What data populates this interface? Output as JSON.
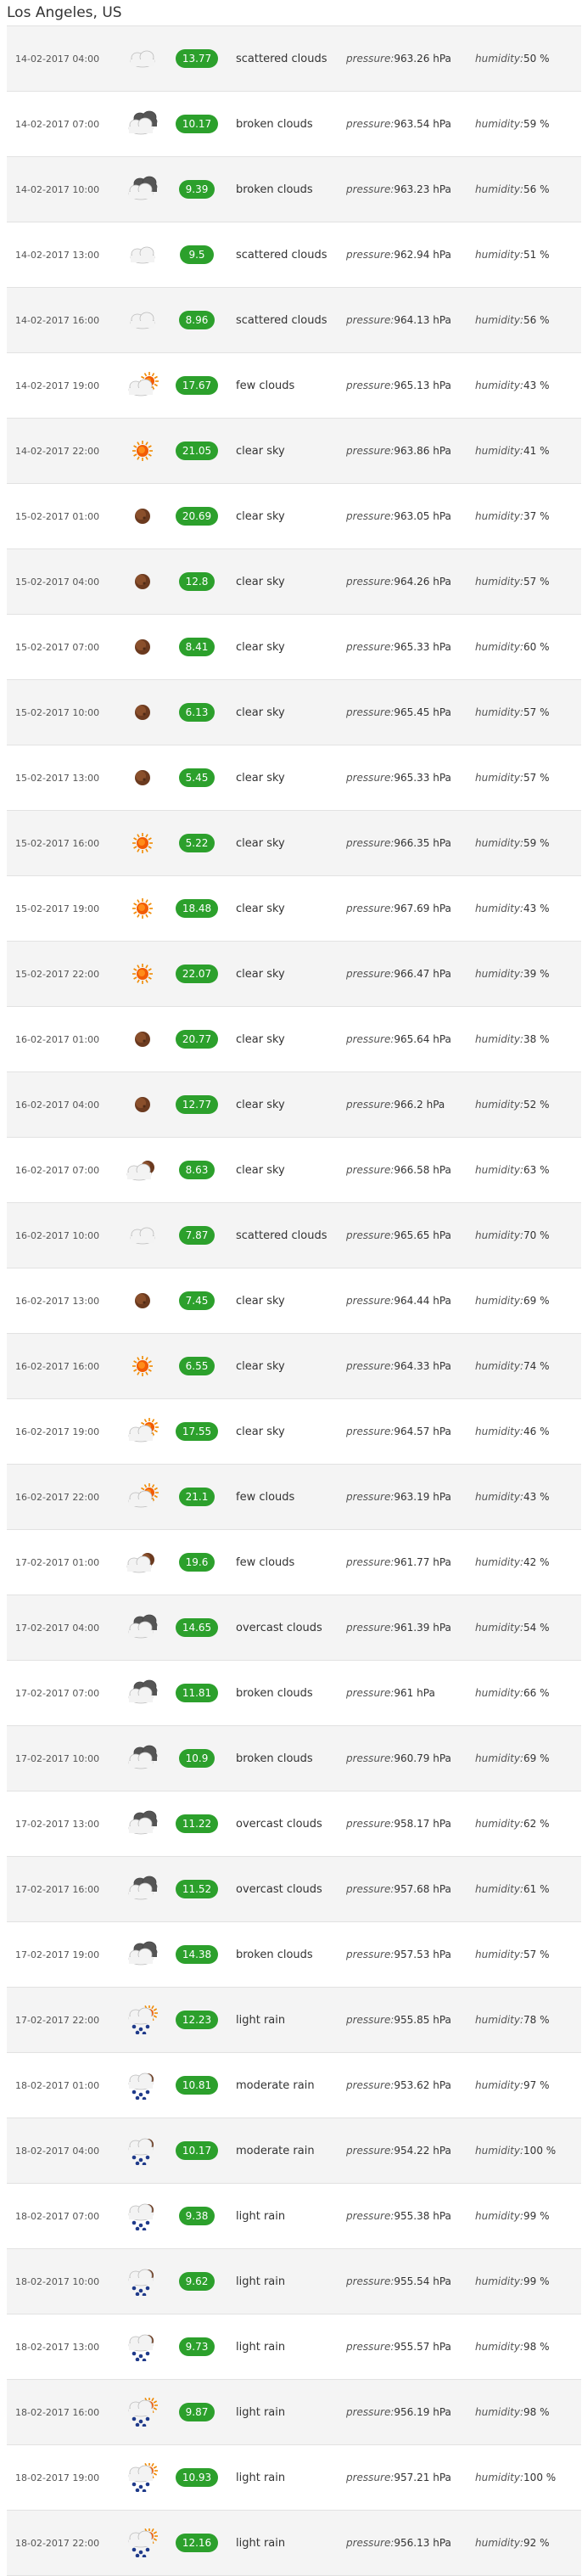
{
  "location": {
    "title": "Los Angeles, US"
  },
  "labels": {
    "pressure": "pressure:",
    "humidity": "humidity:",
    "pressure_unit": "hPa",
    "humidity_unit": "%"
  },
  "colors": {
    "temp_badge": "#2ca02c"
  },
  "forecast": [
    {
      "date": "14-02-2017 04:00",
      "icon": "scattered-clouds-night-icon",
      "temp": "13.77",
      "desc": "scattered clouds",
      "pressure": "963.26",
      "humidity": "50"
    },
    {
      "date": "14-02-2017 07:00",
      "icon": "broken-clouds-icon",
      "temp": "10.17",
      "desc": "broken clouds",
      "pressure": "963.54",
      "humidity": "59"
    },
    {
      "date": "14-02-2017 10:00",
      "icon": "broken-clouds-icon",
      "temp": "9.39",
      "desc": "broken clouds",
      "pressure": "963.23",
      "humidity": "56"
    },
    {
      "date": "14-02-2017 13:00",
      "icon": "scattered-clouds-night-icon",
      "temp": "9.5",
      "desc": "scattered clouds",
      "pressure": "962.94",
      "humidity": "51"
    },
    {
      "date": "14-02-2017 16:00",
      "icon": "scattered-clouds-night-icon",
      "temp": "8.96",
      "desc": "scattered clouds",
      "pressure": "964.13",
      "humidity": "56"
    },
    {
      "date": "14-02-2017 19:00",
      "icon": "few-clouds-day-icon",
      "temp": "17.67",
      "desc": "few clouds",
      "pressure": "965.13",
      "humidity": "43"
    },
    {
      "date": "14-02-2017 22:00",
      "icon": "clear-sky-day-icon",
      "temp": "21.05",
      "desc": "clear sky",
      "pressure": "963.86",
      "humidity": "41"
    },
    {
      "date": "15-02-2017 01:00",
      "icon": "clear-sky-night-icon",
      "temp": "20.69",
      "desc": "clear sky",
      "pressure": "963.05",
      "humidity": "37"
    },
    {
      "date": "15-02-2017 04:00",
      "icon": "clear-sky-night-icon",
      "temp": "12.8",
      "desc": "clear sky",
      "pressure": "964.26",
      "humidity": "57"
    },
    {
      "date": "15-02-2017 07:00",
      "icon": "clear-sky-night-icon",
      "temp": "8.41",
      "desc": "clear sky",
      "pressure": "965.33",
      "humidity": "60"
    },
    {
      "date": "15-02-2017 10:00",
      "icon": "clear-sky-night-icon",
      "temp": "6.13",
      "desc": "clear sky",
      "pressure": "965.45",
      "humidity": "57"
    },
    {
      "date": "15-02-2017 13:00",
      "icon": "clear-sky-night-icon",
      "temp": "5.45",
      "desc": "clear sky",
      "pressure": "965.33",
      "humidity": "57"
    },
    {
      "date": "15-02-2017 16:00",
      "icon": "clear-sky-day-icon",
      "temp": "5.22",
      "desc": "clear sky",
      "pressure": "966.35",
      "humidity": "59"
    },
    {
      "date": "15-02-2017 19:00",
      "icon": "clear-sky-day-icon",
      "temp": "18.48",
      "desc": "clear sky",
      "pressure": "967.69",
      "humidity": "43"
    },
    {
      "date": "15-02-2017 22:00",
      "icon": "clear-sky-day-icon",
      "temp": "22.07",
      "desc": "clear sky",
      "pressure": "966.47",
      "humidity": "39"
    },
    {
      "date": "16-02-2017 01:00",
      "icon": "clear-sky-night-icon",
      "temp": "20.77",
      "desc": "clear sky",
      "pressure": "965.64",
      "humidity": "38"
    },
    {
      "date": "16-02-2017 04:00",
      "icon": "clear-sky-night-icon",
      "temp": "12.77",
      "desc": "clear sky",
      "pressure": "966.2",
      "humidity": "52"
    },
    {
      "date": "16-02-2017 07:00",
      "icon": "few-clouds-night-icon",
      "temp": "8.63",
      "desc": "clear sky",
      "pressure": "966.58",
      "humidity": "63"
    },
    {
      "date": "16-02-2017 10:00",
      "icon": "scattered-clouds-night-icon",
      "temp": "7.87",
      "desc": "scattered clouds",
      "pressure": "965.65",
      "humidity": "70"
    },
    {
      "date": "16-02-2017 13:00",
      "icon": "clear-sky-night-icon",
      "temp": "7.45",
      "desc": "clear sky",
      "pressure": "964.44",
      "humidity": "69"
    },
    {
      "date": "16-02-2017 16:00",
      "icon": "clear-sky-day-icon",
      "temp": "6.55",
      "desc": "clear sky",
      "pressure": "964.33",
      "humidity": "74"
    },
    {
      "date": "16-02-2017 19:00",
      "icon": "few-clouds-day-icon",
      "temp": "17.55",
      "desc": "clear sky",
      "pressure": "964.57",
      "humidity": "46"
    },
    {
      "date": "16-02-2017 22:00",
      "icon": "few-clouds-day-icon",
      "temp": "21.1",
      "desc": "few clouds",
      "pressure": "963.19",
      "humidity": "43"
    },
    {
      "date": "17-02-2017 01:00",
      "icon": "few-clouds-night-icon",
      "temp": "19.6",
      "desc": "few clouds",
      "pressure": "961.77",
      "humidity": "42"
    },
    {
      "date": "17-02-2017 04:00",
      "icon": "broken-clouds-icon",
      "temp": "14.65",
      "desc": "overcast clouds",
      "pressure": "961.39",
      "humidity": "54"
    },
    {
      "date": "17-02-2017 07:00",
      "icon": "broken-clouds-icon",
      "temp": "11.81",
      "desc": "broken clouds",
      "pressure": "961",
      "humidity": "66"
    },
    {
      "date": "17-02-2017 10:00",
      "icon": "broken-clouds-icon",
      "temp": "10.9",
      "desc": "broken clouds",
      "pressure": "960.79",
      "humidity": "69"
    },
    {
      "date": "17-02-2017 13:00",
      "icon": "broken-clouds-icon",
      "temp": "11.22",
      "desc": "overcast clouds",
      "pressure": "958.17",
      "humidity": "62"
    },
    {
      "date": "17-02-2017 16:00",
      "icon": "broken-clouds-icon",
      "temp": "11.52",
      "desc": "overcast clouds",
      "pressure": "957.68",
      "humidity": "61"
    },
    {
      "date": "17-02-2017 19:00",
      "icon": "broken-clouds-icon",
      "temp": "14.38",
      "desc": "broken clouds",
      "pressure": "957.53",
      "humidity": "57"
    },
    {
      "date": "17-02-2017 22:00",
      "icon": "rain-day-icon",
      "temp": "12.23",
      "desc": "light rain",
      "pressure": "955.85",
      "humidity": "78"
    },
    {
      "date": "18-02-2017 01:00",
      "icon": "rain-night-icon",
      "temp": "10.81",
      "desc": "moderate rain",
      "pressure": "953.62",
      "humidity": "97"
    },
    {
      "date": "18-02-2017 04:00",
      "icon": "rain-night-icon",
      "temp": "10.17",
      "desc": "moderate rain",
      "pressure": "954.22",
      "humidity": "100"
    },
    {
      "date": "18-02-2017 07:00",
      "icon": "rain-night-icon",
      "temp": "9.38",
      "desc": "light rain",
      "pressure": "955.38",
      "humidity": "99"
    },
    {
      "date": "18-02-2017 10:00",
      "icon": "rain-night-icon",
      "temp": "9.62",
      "desc": "light rain",
      "pressure": "955.54",
      "humidity": "99"
    },
    {
      "date": "18-02-2017 13:00",
      "icon": "rain-night-icon",
      "temp": "9.73",
      "desc": "light rain",
      "pressure": "955.57",
      "humidity": "98"
    },
    {
      "date": "18-02-2017 16:00",
      "icon": "rain-day-icon",
      "temp": "9.87",
      "desc": "light rain",
      "pressure": "956.19",
      "humidity": "98"
    },
    {
      "date": "18-02-2017 19:00",
      "icon": "rain-day-icon",
      "temp": "10.93",
      "desc": "light rain",
      "pressure": "957.21",
      "humidity": "100"
    },
    {
      "date": "18-02-2017 22:00",
      "icon": "rain-day-icon",
      "temp": "12.16",
      "desc": "light rain",
      "pressure": "956.13",
      "humidity": "92"
    }
  ]
}
